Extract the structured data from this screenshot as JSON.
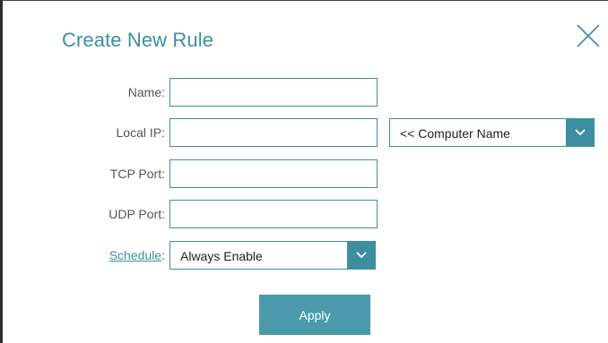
{
  "dialog": {
    "title": "Create New Rule"
  },
  "form": {
    "name_label": "Name:",
    "name_value": "",
    "local_ip_label": "Local IP:",
    "local_ip_value": "",
    "computer_name_select": "<< Computer Name",
    "tcp_port_label": "TCP Port:",
    "tcp_port_value": "",
    "udp_port_label": "UDP Port:",
    "udp_port_value": "",
    "schedule_label": "Schedule",
    "schedule_colon": ":",
    "schedule_select": "Always Enable"
  },
  "actions": {
    "apply_label": "Apply"
  },
  "icons": {
    "close": "close-icon",
    "dropdown": "chevron-down-icon"
  },
  "colors": {
    "accent": "#3d8fa0",
    "button": "#4a9aab"
  }
}
